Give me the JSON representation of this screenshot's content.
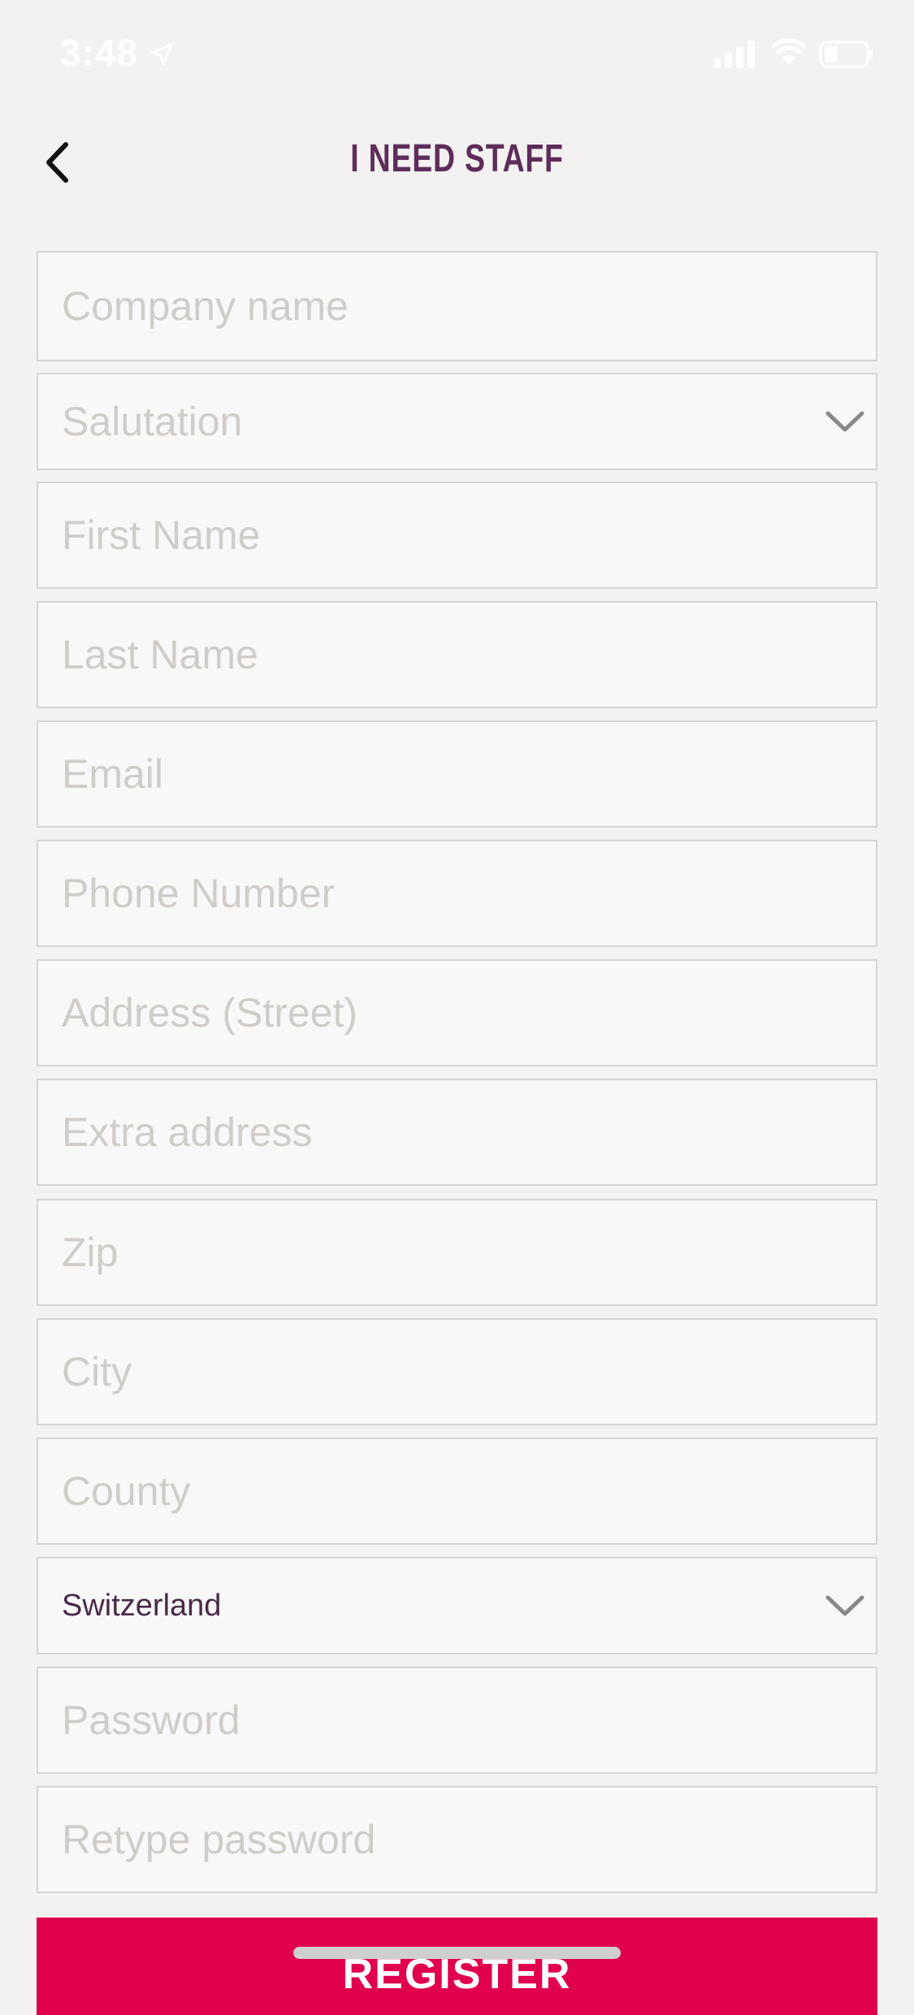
{
  "status_bar": {
    "time": "3:48",
    "icons": [
      "location-arrow-icon",
      "cellular-signal-icon",
      "wifi-icon",
      "battery-icon"
    ]
  },
  "nav": {
    "back_icon": "chevron-left-icon",
    "title": "I NEED STAFF"
  },
  "form": {
    "company_name": {
      "placeholder": "Company name",
      "value": ""
    },
    "salutation": {
      "placeholder": "Salutation",
      "value": ""
    },
    "first_name": {
      "placeholder": "First Name",
      "value": ""
    },
    "last_name": {
      "placeholder": "Last Name",
      "value": ""
    },
    "email": {
      "placeholder": "Email",
      "value": ""
    },
    "phone": {
      "placeholder": "Phone Number",
      "value": ""
    },
    "address_street": {
      "placeholder": "Address (Street)",
      "value": ""
    },
    "extra_address": {
      "placeholder": "Extra address",
      "value": ""
    },
    "zip": {
      "placeholder": "Zip",
      "value": ""
    },
    "city": {
      "placeholder": "City",
      "value": ""
    },
    "county": {
      "placeholder": "County",
      "value": ""
    },
    "country": {
      "value": "Switzerland"
    },
    "password": {
      "placeholder": "Password",
      "value": ""
    },
    "retype_password": {
      "placeholder": "Retype password",
      "value": ""
    }
  },
  "register_label": "REGISTER",
  "colors": {
    "background": "#f3f2f1",
    "field_background": "#f8f8f8",
    "field_border": "#d6d5d3",
    "placeholder": "#d0cdc9",
    "title": "#5e2d5a",
    "accent": "#e0004e"
  }
}
